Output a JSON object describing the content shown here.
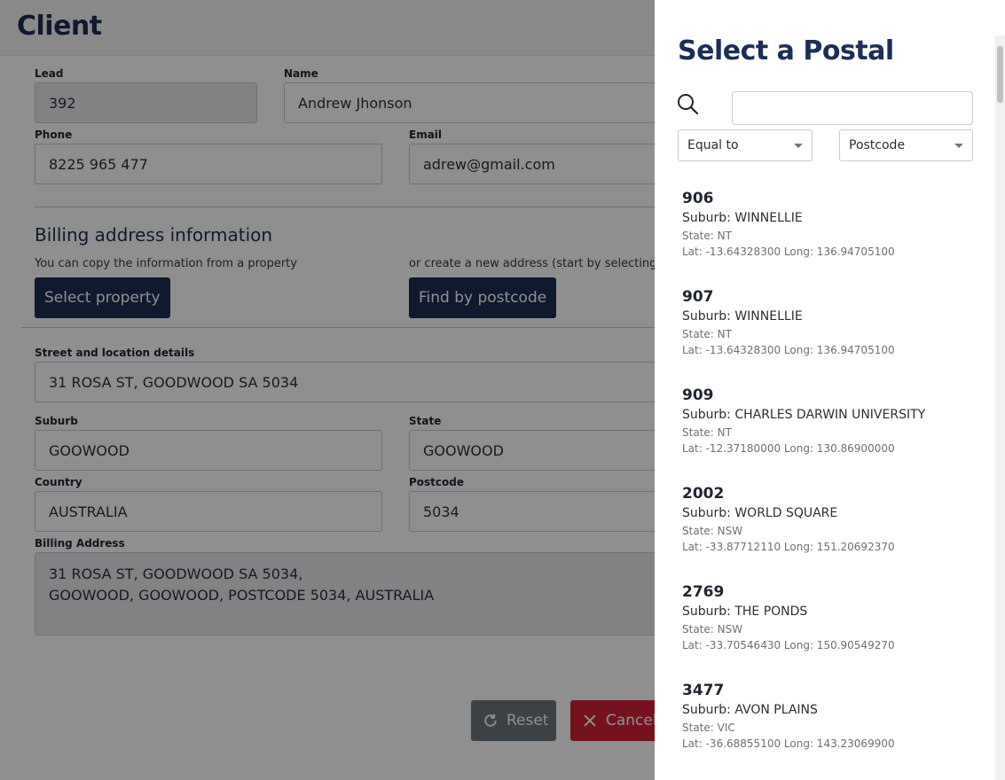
{
  "page": {
    "title": "Client",
    "fields": {
      "lead": {
        "label": "Lead",
        "value": "392"
      },
      "name": {
        "label": "Name",
        "value": "Andrew Jhonson"
      },
      "phone": {
        "label": "Phone",
        "value": "8225 965 477"
      },
      "email": {
        "label": "Email",
        "value": "adrew@gmail.com"
      },
      "street": {
        "label": "Street and location details",
        "value": "31 ROSA ST, GOODWOOD SA 5034"
      },
      "suburb": {
        "label": "Suburb",
        "value": "GOOWOOD"
      },
      "state": {
        "label": "State",
        "value": "GOOWOOD"
      },
      "country": {
        "label": "Country",
        "value": "AUSTRALIA"
      },
      "postcode": {
        "label": "Postcode",
        "value": "5034"
      },
      "billing_address": {
        "label": "Billing Address",
        "line1": "31 ROSA ST, GOODWOOD SA 5034,",
        "line2": "GOOWOOD, GOOWOOD, POSTCODE 5034, AUSTRALIA"
      }
    },
    "billing_section": {
      "title": "Billing address information",
      "copy_hint": "You can copy the information from a property",
      "create_hint": "or create a new address (start by selecting a",
      "select_property_label": "Select property",
      "find_postcode_label": "Find by postcode"
    },
    "actions": {
      "reset_label": "Reset",
      "cancel_label": "Cancel"
    }
  },
  "drawer": {
    "title": "Select a Postal",
    "search": {
      "placeholder": "",
      "value": ""
    },
    "operator_select": {
      "value": "Equal to"
    },
    "field_select": {
      "value": "Postcode"
    },
    "results": [
      {
        "code": "906",
        "suburb": "Suburb: WINNELLIE",
        "state": "State: NT",
        "latlong": "Lat: -13.64328300 Long: 136.94705100"
      },
      {
        "code": "907",
        "suburb": "Suburb: WINNELLIE",
        "state": "State: NT",
        "latlong": "Lat: -13.64328300 Long: 136.94705100"
      },
      {
        "code": "909",
        "suburb": "Suburb: CHARLES DARWIN UNIVERSITY",
        "state": "State: NT",
        "latlong": "Lat: -12.37180000 Long: 130.86900000"
      },
      {
        "code": "2002",
        "suburb": "Suburb: WORLD SQUARE",
        "state": "State: NSW",
        "latlong": "Lat: -33.87712110 Long: 151.20692370"
      },
      {
        "code": "2769",
        "suburb": "Suburb: THE PONDS",
        "state": "State: NSW",
        "latlong": "Lat: -33.70546430 Long: 150.90549270"
      },
      {
        "code": "3477",
        "suburb": "Suburb: AVON PLAINS",
        "state": "State: VIC",
        "latlong": "Lat: -36.68855100 Long: 143.23069900"
      }
    ]
  },
  "colors": {
    "navy": "#1b2e55",
    "danger": "#d32035",
    "secondary": "#6c757d"
  }
}
